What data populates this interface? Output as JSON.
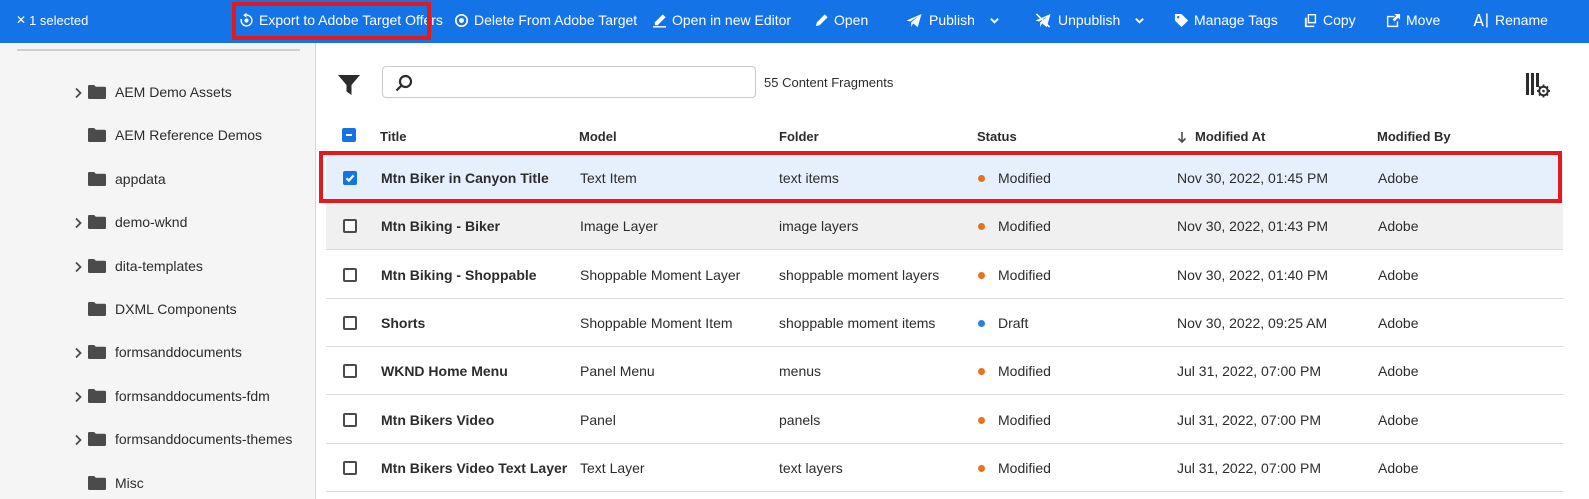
{
  "actionbar": {
    "selected_text": "1 selected",
    "items": [
      {
        "label": "Export to Adobe Target Offers",
        "icon": "target-export-icon"
      },
      {
        "label": "Delete From Adobe Target",
        "icon": "target-delete-icon"
      },
      {
        "label": "Open in new Editor",
        "icon": "edit-icon"
      },
      {
        "label": "Open",
        "icon": "pencil-icon"
      },
      {
        "label": "Publish",
        "icon": "publish-icon"
      },
      {
        "label": "Unpublish",
        "icon": "unpublish-icon"
      },
      {
        "label": "Manage Tags",
        "icon": "tag-icon"
      },
      {
        "label": "Copy",
        "icon": "copy-icon"
      },
      {
        "label": "Move",
        "icon": "move-icon"
      },
      {
        "label": "Rename",
        "icon": "rename-icon"
      }
    ],
    "bg_color": "#1473e6",
    "highlight_color": "#e3191b"
  },
  "rail": {
    "items": [
      {
        "label": "AEM Demo Assets",
        "expandable": true
      },
      {
        "label": "AEM Reference Demos",
        "expandable": false
      },
      {
        "label": "appdata",
        "expandable": false
      },
      {
        "label": "demo-wknd",
        "expandable": true
      },
      {
        "label": "dita-templates",
        "expandable": true
      },
      {
        "label": "DXML Components",
        "expandable": false
      },
      {
        "label": "formsanddocuments",
        "expandable": true
      },
      {
        "label": "formsanddocuments-fdm",
        "expandable": true
      },
      {
        "label": "formsanddocuments-themes",
        "expandable": true
      },
      {
        "label": "Misc",
        "expandable": false
      }
    ]
  },
  "toolbar": {
    "search_placeholder": "",
    "count_text": "55 Content Fragments"
  },
  "table": {
    "headers": {
      "title": "Title",
      "model": "Model",
      "folder": "Folder",
      "status": "Status",
      "modified_at": "Modified At",
      "modified_by": "Modified By"
    },
    "rows": [
      {
        "title": "Mtn Biker in Canyon Title",
        "model": "Text Item",
        "folder": "text items",
        "status": "Modified",
        "status_color": "#e8711c",
        "modified_at": "Nov 30, 2022, 01:45 PM",
        "modified_by": "Adobe",
        "selected": true
      },
      {
        "title": "Mtn Biking - Biker",
        "model": "Image Layer",
        "folder": "image layers",
        "status": "Modified",
        "status_color": "#e8711c",
        "modified_at": "Nov 30, 2022, 01:43 PM",
        "modified_by": "Adobe",
        "selected": false
      },
      {
        "title": "Mtn Biking - Shoppable",
        "model": "Shoppable Moment Layer",
        "folder": "shoppable moment layers",
        "status": "Modified",
        "status_color": "#e8711c",
        "modified_at": "Nov 30, 2022, 01:40 PM",
        "modified_by": "Adobe",
        "selected": false
      },
      {
        "title": "Shorts",
        "model": "Shoppable Moment Item",
        "folder": "shoppable moment items",
        "status": "Draft",
        "status_color": "#2680eb",
        "modified_at": "Nov 30, 2022, 09:25 AM",
        "modified_by": "Adobe",
        "selected": false
      },
      {
        "title": "WKND Home Menu",
        "model": "Panel Menu",
        "folder": "menus",
        "status": "Modified",
        "status_color": "#e8711c",
        "modified_at": "Jul 31, 2022, 07:00 PM",
        "modified_by": "Adobe",
        "selected": false
      },
      {
        "title": "Mtn Bikers Video",
        "model": "Panel",
        "folder": "panels",
        "status": "Modified",
        "status_color": "#e8711c",
        "modified_at": "Jul 31, 2022, 07:00 PM",
        "modified_by": "Adobe",
        "selected": false
      },
      {
        "title": "Mtn Bikers Video Text Layer",
        "model": "Text Layer",
        "folder": "text layers",
        "status": "Modified",
        "status_color": "#e8711c",
        "modified_at": "Jul 31, 2022, 07:00 PM",
        "modified_by": "Adobe",
        "selected": false
      }
    ]
  }
}
